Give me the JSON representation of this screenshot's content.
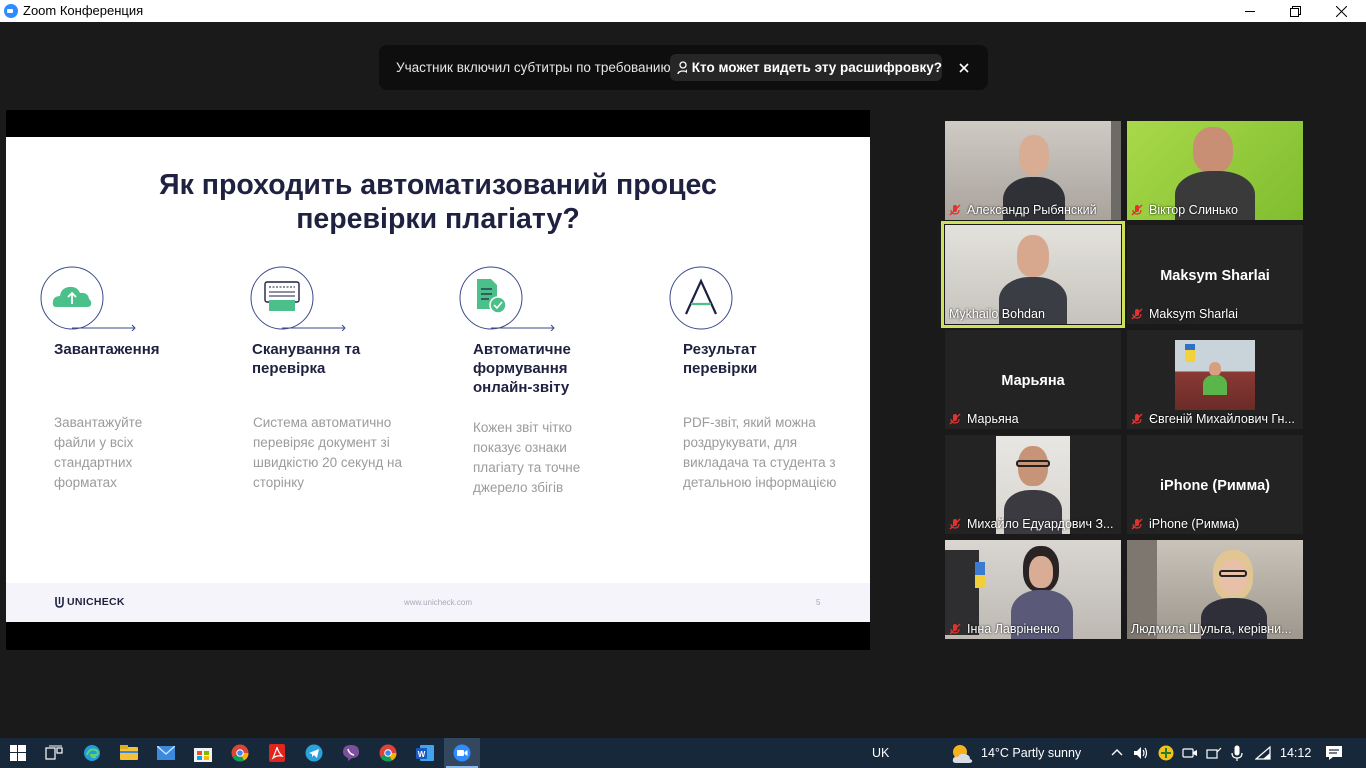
{
  "window": {
    "title": "Zoom Конференция"
  },
  "banner": {
    "message": "Участник включил субтитры по требованию",
    "link_label": "Кто может видеть эту расшифровку?"
  },
  "slide": {
    "title_line1": "Як проходить автоматизований процес",
    "title_line2": "перевірки плагіату?",
    "steps": [
      {
        "heading": "Завантаження",
        "text": "Завантажуйте файли у всіх стандартних форматах",
        "icon": "cloud-upload-icon"
      },
      {
        "heading": "Сканування та перевірка",
        "text": "Система автоматично перевіряє документ зі швидкістю 20 секунд на сторінку",
        "icon": "scanner-icon"
      },
      {
        "heading": "Автоматичне формування онлайн-звіту",
        "text": "Кожен звіт чітко показує ознаки плагіату та точне джерело збігів",
        "icon": "document-check-icon"
      },
      {
        "heading": "Результат перевірки",
        "text": "PDF-звіт, який можна роздрукувати, для викладача та студента з детальною інформацією",
        "icon": "letter-a-icon"
      }
    ],
    "footer": {
      "logo": "UNICHECK",
      "url": "www.unicheck.com",
      "page": "5"
    }
  },
  "participants": [
    {
      "name": "Александр Рыбянский",
      "video": true,
      "muted": true
    },
    {
      "name": "Віктор Слинько",
      "video": true,
      "muted": true
    },
    {
      "name": "Mykhailo Bohdan",
      "video": true,
      "muted": false,
      "active_speaker": true
    },
    {
      "name": "Maksym Sharlai",
      "video": false,
      "muted": false
    },
    {
      "name": "Марьяна",
      "video": false,
      "muted": true
    },
    {
      "name": "Євгеній Михайлович Гн...",
      "video": true,
      "muted": true
    },
    {
      "name": "Михайло Едуардович З...",
      "video": true,
      "muted": true
    },
    {
      "name": "iPhone (Римма)",
      "video": false,
      "muted": true
    },
    {
      "name": "Інна Лавріненко",
      "video": true,
      "muted": true
    },
    {
      "name": "Людмила Шульга, керівни...",
      "video": true,
      "muted": false
    }
  ],
  "taskbar": {
    "pinned": [
      "windows-start",
      "task-view",
      "edge",
      "file-explorer",
      "mail",
      "store",
      "chrome",
      "acrobat",
      "telegram",
      "viber",
      "chrome",
      "word",
      "zoom"
    ],
    "language": "UK",
    "weather": "14°C  Partly sunny",
    "time": "14:12"
  },
  "colors": {
    "accent_speaker": "#cfe05a",
    "muted_mic": "#e0332f",
    "slide_title": "#1e2140",
    "zoom_blue": "#2d8cff"
  }
}
